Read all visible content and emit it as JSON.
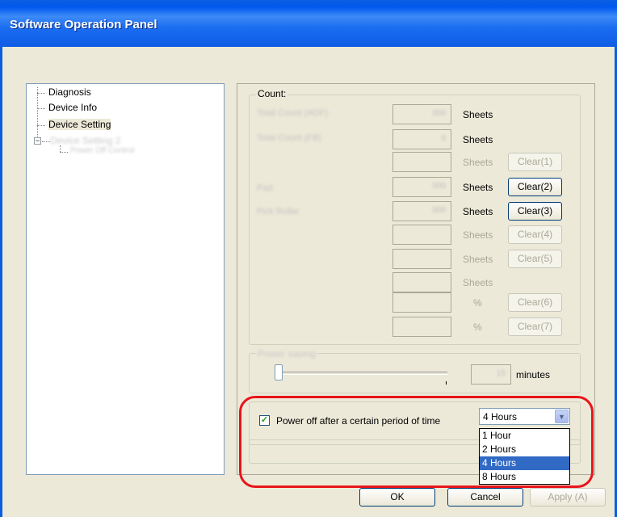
{
  "window": {
    "title": "Software Operation Panel"
  },
  "tree": {
    "items": [
      {
        "label": "Diagnosis"
      },
      {
        "label": "Device Info"
      },
      {
        "label": "Device Setting"
      }
    ]
  },
  "count": {
    "group_label": "Count:",
    "units": {
      "sheets": "Sheets",
      "percent": "%"
    },
    "clear_buttons": [
      "Clear(1)",
      "Clear(2)",
      "Clear(3)",
      "Clear(4)",
      "Clear(5)",
      "Clear(6)",
      "Clear(7)"
    ]
  },
  "power": {
    "minutes_label": "minutes",
    "checkbox_label": "Power off after a certain period of time",
    "checkbox_checked": true,
    "combo_value": "4 Hours",
    "options": [
      "1 Hour",
      "2 Hours",
      "4 Hours",
      "8 Hours"
    ],
    "selected_index": 2
  },
  "buttons": {
    "ok": "OK",
    "cancel": "Cancel",
    "apply": "Apply (A)"
  },
  "colors": {
    "title_bar": "#0a5ee0",
    "highlight": "#316ac5",
    "annotation_ring": "#e8141b"
  }
}
